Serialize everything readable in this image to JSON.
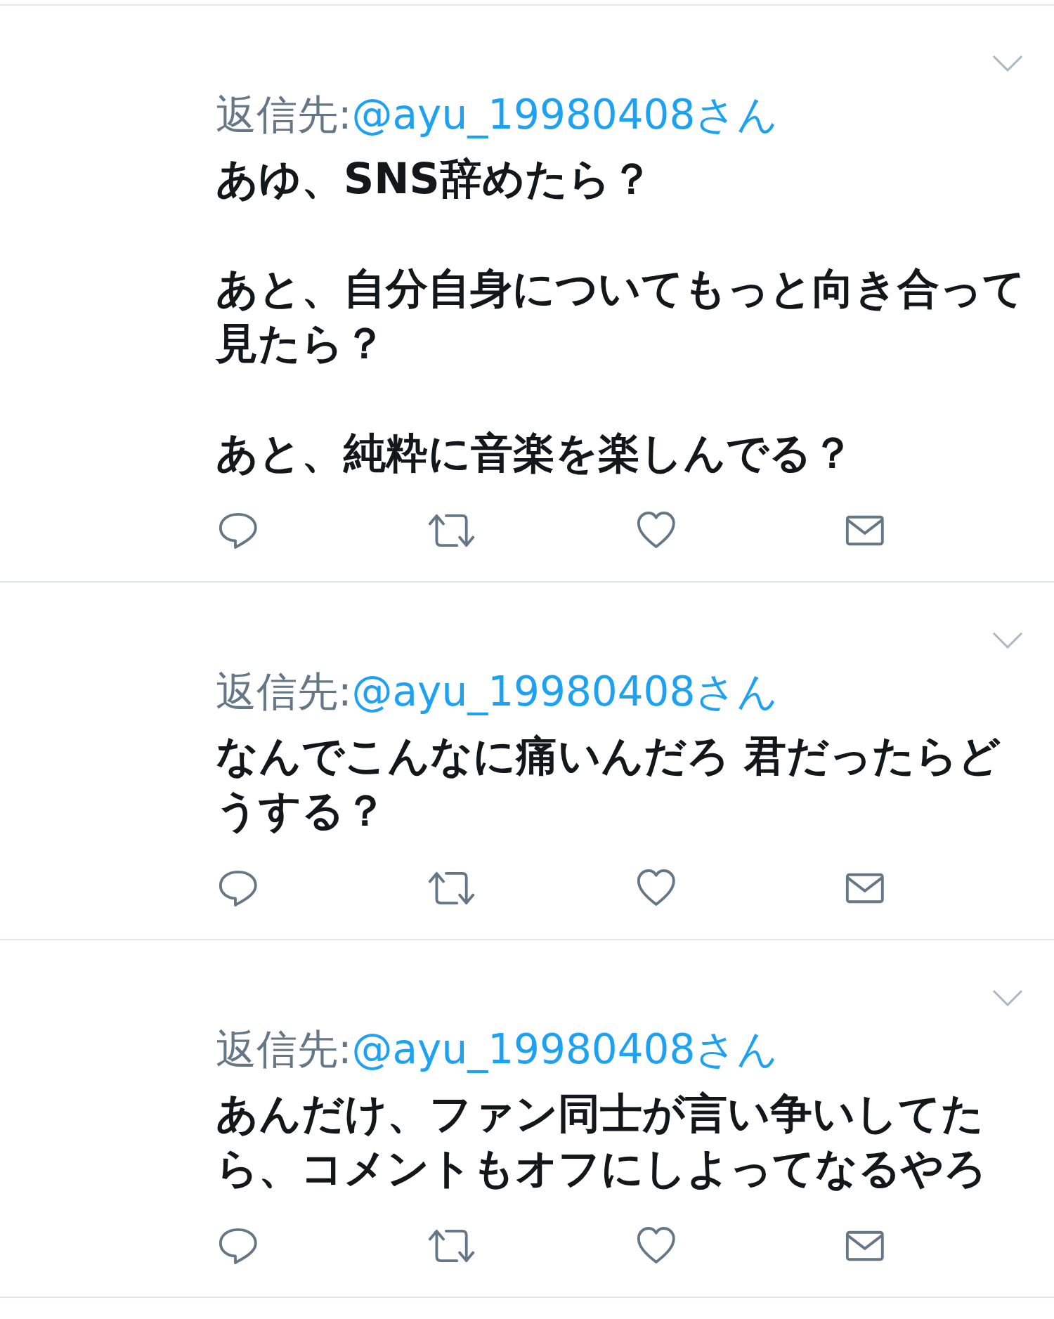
{
  "tweets": [
    {
      "reply_label": "返信先:",
      "reply_handle": "@ayu_19980408さん",
      "paragraphs": [
        "あゆ、SNS辞めたら？",
        "あと、自分自身についてもっと向き合って見たら？",
        "あと、純粋に音楽を楽しんでる？"
      ]
    },
    {
      "reply_label": "返信先:",
      "reply_handle": "@ayu_19980408さん",
      "paragraphs": [
        "なんでこんなに痛いんだろ 君だったらどうする？"
      ]
    },
    {
      "reply_label": "返信先:",
      "reply_handle": "@ayu_19980408さん",
      "paragraphs": [
        "あんだけ、ファン同士が言い争いしてたら、コメントもオフにしよってなるやろ"
      ]
    }
  ]
}
